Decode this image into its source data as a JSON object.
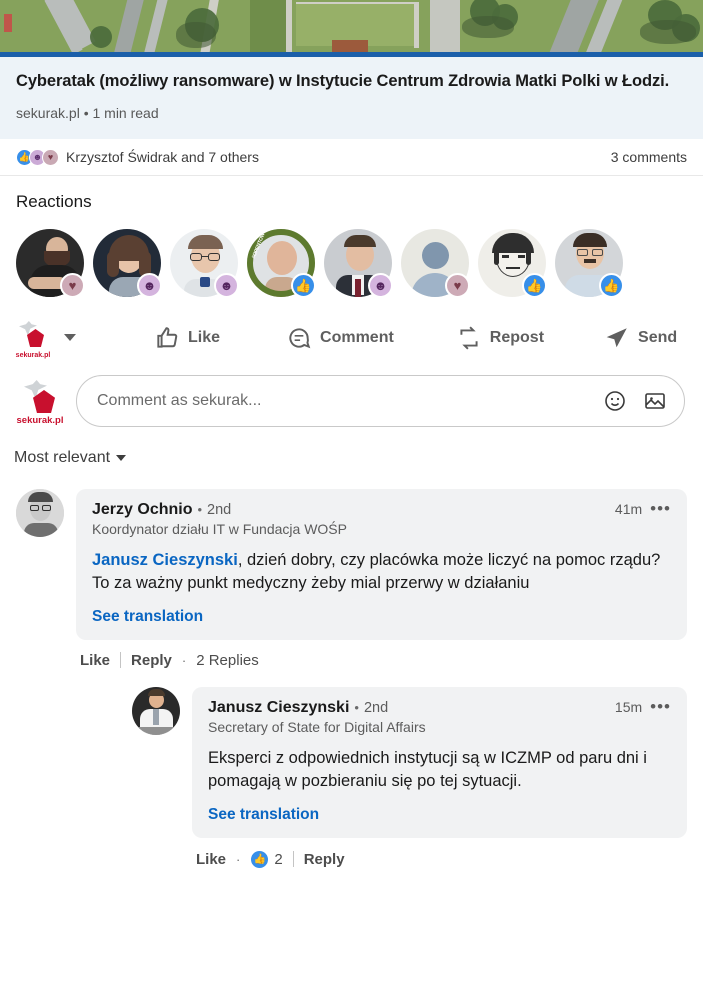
{
  "article": {
    "image_alt": "aerial-satellite-view",
    "title": "Cyberatak (możliwy ransomware) w Instytucie Centrum Zdrowia Matki Polki w Łodzi.",
    "source": "sekurak.pl • 1 min read"
  },
  "social_proof": {
    "reaction_icons": [
      "like-icon",
      "curious-icon",
      "support-icon"
    ],
    "names": "Krzysztof Świdrak and 7 others",
    "comments_count": "3 comments"
  },
  "reactions": {
    "title": "Reactions",
    "avatars": [
      {
        "name": "reactor-avatar-1",
        "badge": "support-icon",
        "badge_glyph": "♥",
        "badge_class": "b-support",
        "open_to_work": false
      },
      {
        "name": "reactor-avatar-2",
        "badge": "curious-icon",
        "badge_glyph": "☻",
        "badge_class": "b-curious",
        "open_to_work": false
      },
      {
        "name": "reactor-avatar-3",
        "badge": "curious-icon",
        "badge_glyph": "☻",
        "badge_class": "b-curious",
        "open_to_work": false
      },
      {
        "name": "reactor-avatar-4",
        "badge": "like-icon",
        "badge_glyph": "👍",
        "badge_class": "b-like",
        "open_to_work": true,
        "open_to_work_text": "#OPENTOWORK"
      },
      {
        "name": "reactor-avatar-5",
        "badge": "curious-icon",
        "badge_glyph": "☻",
        "badge_class": "b-curious",
        "open_to_work": false
      },
      {
        "name": "reactor-avatar-6",
        "badge": "support-icon",
        "badge_glyph": "♥",
        "badge_class": "b-support",
        "open_to_work": false
      },
      {
        "name": "reactor-avatar-7",
        "badge": "like-icon",
        "badge_glyph": "👍",
        "badge_class": "b-like",
        "open_to_work": false
      },
      {
        "name": "reactor-avatar-8",
        "badge": "like-icon",
        "badge_glyph": "👍",
        "badge_class": "b-like",
        "open_to_work": false
      }
    ]
  },
  "action_bar": {
    "reactor_logo_text": "sekurak.pl",
    "like_label": "Like",
    "comment_label": "Comment",
    "repost_label": "Repost",
    "send_label": "Send"
  },
  "comment_box": {
    "avatar_text": "sekurak.pl",
    "placeholder": "Comment as sekurak...",
    "emoji_icon": "emoji-icon",
    "image_icon": "image-icon"
  },
  "sort": {
    "label": "Most relevant"
  },
  "comments": [
    {
      "author": "Jerzy Ochnio",
      "dot": "•",
      "degree": "2nd",
      "time": "41m",
      "more": "•••",
      "headline": "Koordynator działu IT w Fundacja WOŚP",
      "mention": "Janusz Cieszynski",
      "text": ", dzień dobry, czy placówka może liczyć na pomoc rządu? To za ważny punkt medyczny żeby mial przerwy w działaniu",
      "translate": "See translation",
      "like_label": "Like",
      "reply_label": "Reply",
      "replies_dot": "·",
      "replies_label": "2 Replies"
    }
  ],
  "reply": {
    "author": "Janusz Cieszynski",
    "dot": "•",
    "degree": "2nd",
    "time": "15m",
    "more": "•••",
    "headline": "Secretary of State for Digital Affairs",
    "text": "Eksperci z odpowiednich instytucji są w ICZMP od paru dni i pomagają w pozbieraniu się po tej sytuacji.",
    "translate": "See translation",
    "like_label": "Like",
    "like_dot": "·",
    "like_count": "2",
    "like_badge": "like-icon",
    "reply_label": "Reply"
  },
  "colors": {
    "link": "#0a66c2",
    "like_blue": "#378fe9",
    "article_bg": "#edf3f8",
    "bubble_bg": "#f1f2f3",
    "brand_red": "#c8102e",
    "accent_line": "#1b5faa"
  }
}
